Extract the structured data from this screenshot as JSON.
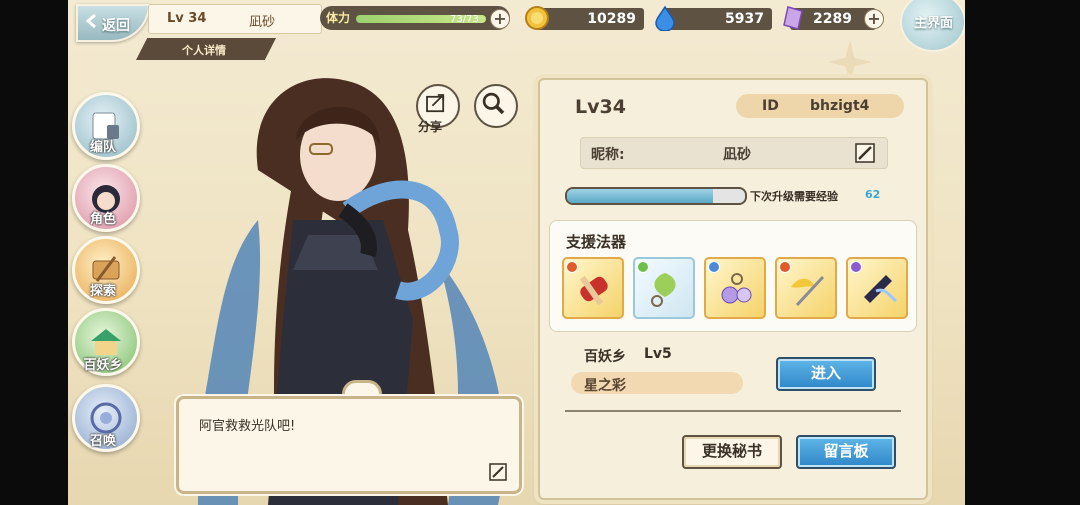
{
  "topbar": {
    "back_label": "返回",
    "player_level": "Lv 34",
    "player_name": "凪砂",
    "subtab_label": "个人详情",
    "stamina_label": "体力",
    "stamina_value": "73/73",
    "stamina_fraction": 1.0,
    "gold": "10289",
    "water": "5937",
    "crystal": "2289",
    "world_label": "主界面"
  },
  "leftnav": {
    "items": [
      {
        "label": "编队"
      },
      {
        "label": "角色"
      },
      {
        "label": "探索"
      },
      {
        "label": "百妖乡"
      },
      {
        "label": "召唤"
      }
    ]
  },
  "character": {
    "share_label": "分享",
    "dialog_text": "阿官救救光队吧!"
  },
  "profile": {
    "level": "Lv34",
    "id_label": "ID",
    "id_value": "bhzigt4",
    "nickname_label": "昵称:",
    "nickname_value": "凪砂",
    "exp_label": "下次升级需要经验",
    "exp_value": "62",
    "exp_fraction": 0.82,
    "support_title": "支援法器",
    "artifacts": [
      {
        "icon": "red-scroll-artifact",
        "element_color": "#e05a2a"
      },
      {
        "icon": "leaf-bell-artifact",
        "element_color": "#6cc04a"
      },
      {
        "icon": "earring-orb-artifact",
        "element_color": "#4a8ad8"
      },
      {
        "icon": "golden-wing-sword-artifact",
        "element_color": "#e05a2a"
      },
      {
        "icon": "dark-blade-artifact",
        "element_color": "#8a5ad0"
      }
    ],
    "village_name": "百妖乡",
    "village_level": "Lv5",
    "village_sub": "星之彩",
    "enter_label": "进入",
    "change_secretary_label": "更换秘书",
    "message_board_label": "留言板"
  },
  "colors": {
    "panel_bg": "#f6efdb",
    "accent_blue": "#3a8fd0",
    "exp_value_color": "#3aa6d8",
    "border_dark": "#5e5343"
  }
}
